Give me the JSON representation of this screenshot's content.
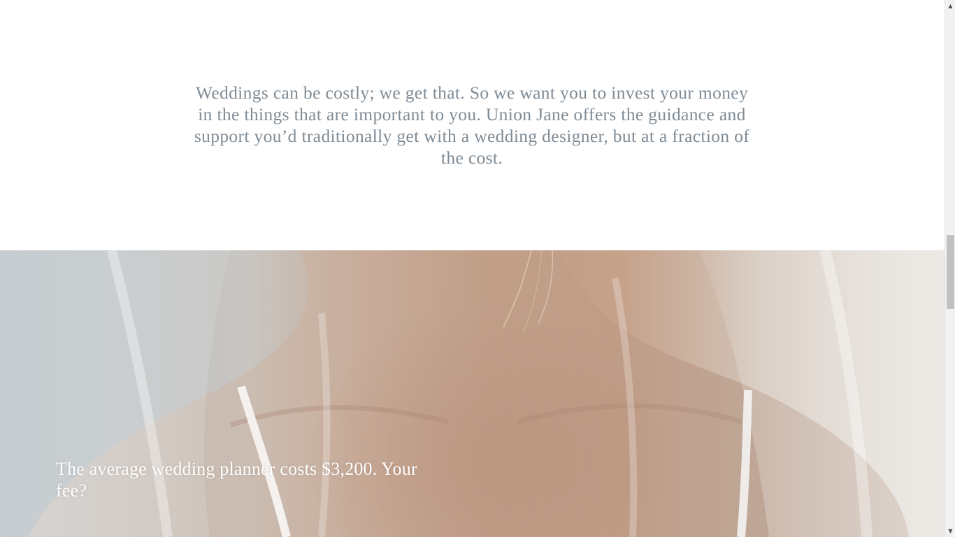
{
  "intro": {
    "text": "Weddings can be costly; we get that. So we want you to invest your money in the things that are important to you. Union Jane offers the guidance and support you’d traditionally get with a wedding designer, but at a fraction of the cost."
  },
  "hero": {
    "heading": "The average wedding planner costs $3,200. Your fee?"
  },
  "scrollbar": {
    "up_arrow": "▲",
    "down_arrow": "▼",
    "scroll_fraction": 0.44
  },
  "colors": {
    "intro_text": "#7f8b95",
    "hero_text": "#ffffff",
    "background": "#ffffff"
  }
}
